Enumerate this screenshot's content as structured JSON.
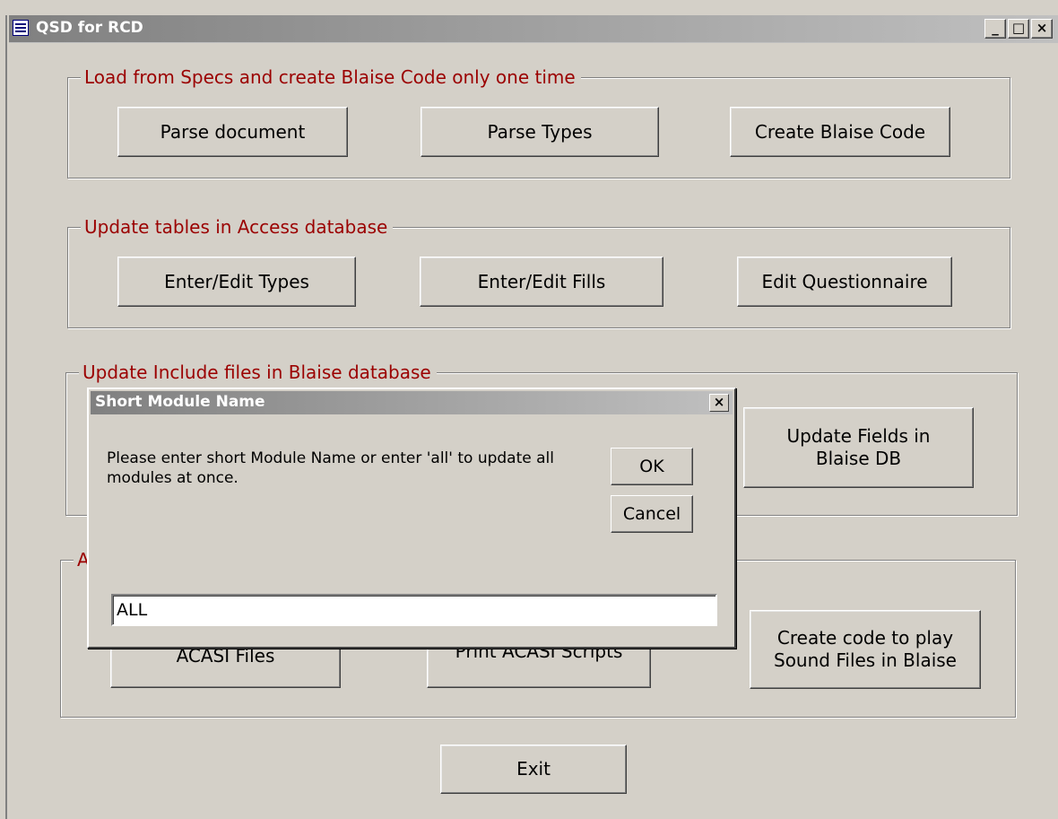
{
  "window": {
    "title": "QSD for RCD",
    "icon": "form-icon",
    "controls": {
      "minimize": "_",
      "maximize": "□",
      "close": "×"
    }
  },
  "groups": [
    {
      "legend": "Load from Specs and create Blaise Code only one  time",
      "buttons": [
        "Parse document",
        "Parse Types",
        "Create Blaise Code"
      ]
    },
    {
      "legend": "Update tables in Access database",
      "buttons": [
        "Enter/Edit Types",
        "Enter/Edit Fills",
        "Edit Questionnaire"
      ]
    },
    {
      "legend": "Update Include files in Blaise database",
      "buttons": [
        "Update Fields in\nBlaise DB"
      ]
    },
    {
      "legend": "A",
      "buttons": [
        "ACASI Files",
        "Print ACASI Scripts",
        "Create code to play\nSound Files in Blaise"
      ]
    }
  ],
  "exit_label": "Exit",
  "dialog": {
    "title": "Short Module Name",
    "close": "×",
    "message": "Please enter short Module Name or enter 'all' to update all modules at once.",
    "ok_label": "OK",
    "cancel_label": "Cancel",
    "input_value": "ALL"
  },
  "colors": {
    "legend_text": "#9b0000",
    "face": "#d4d0c8",
    "titlebar_start": "#808080"
  }
}
